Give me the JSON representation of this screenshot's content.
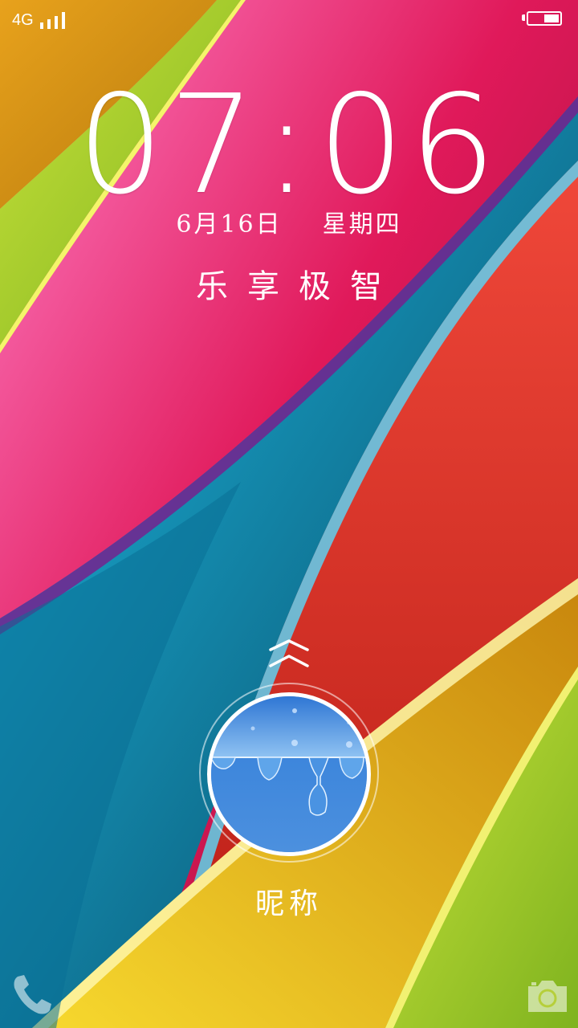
{
  "status_bar": {
    "network": "4G",
    "signal_bars": 4,
    "battery_level": 0.5
  },
  "lockscreen": {
    "time": {
      "hours": "07",
      "separator": ":",
      "minutes": "06"
    },
    "date": {
      "day": "6月16日",
      "weekday": "星期四"
    },
    "slogan": "乐享极智",
    "user": {
      "nickname": "昵称"
    }
  },
  "shortcuts": {
    "left": "phone-icon",
    "right": "camera-icon"
  },
  "colors": {
    "magenta": "#e0195a",
    "pink": "#ff6fb8",
    "cyan": "#12a6cf",
    "red": "#d9322c",
    "yellow": "#f3c925",
    "lime": "#a8cf2e",
    "avatar_blue": "#4a8ad8"
  }
}
